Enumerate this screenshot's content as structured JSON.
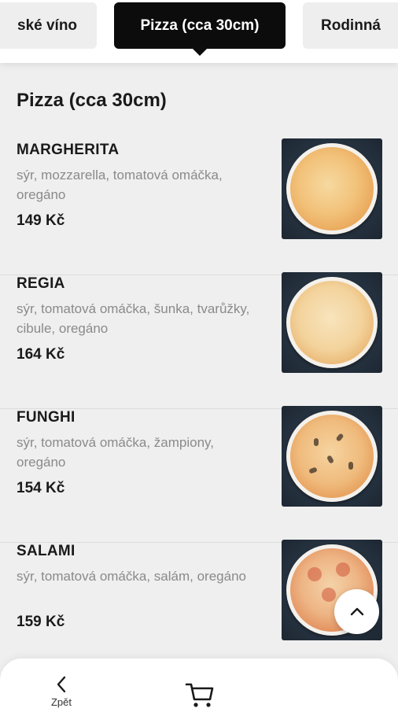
{
  "categories": [
    {
      "label": "ské víno",
      "active": false
    },
    {
      "label": "Pizza (cca 30cm)",
      "active": true
    },
    {
      "label": "Rodinná",
      "active": false
    }
  ],
  "section": {
    "title": "Pizza (cca 30cm)"
  },
  "items": [
    {
      "name": "MARGHERITA",
      "description": "sýr, mozzarella, tomatová omáčka, oregáno",
      "price": "149 Kč"
    },
    {
      "name": "REGIA",
      "description": "sýr, tomatová omáčka, šunka, tvarůžky, cibule, oregáno",
      "price": "164 Kč"
    },
    {
      "name": "FUNGHI",
      "description": "sýr, tomatová omáčka, žampiony, oregáno",
      "price": "154 Kč"
    },
    {
      "name": "SALAMI",
      "description": "sýr, tomatová omáčka, salám, oregáno",
      "price": "159 Kč"
    }
  ],
  "scroll_top": {
    "icon": "chevron-up-icon"
  },
  "bottom_nav": {
    "back_label": "Zpět",
    "back_icon": "chevron-left-icon",
    "cart_icon": "cart-icon"
  },
  "colors": {
    "background": "#efefef",
    "active_tab": "#0c0c0c",
    "inactive_tab": "#eeeeee",
    "description": "#8a8a8a"
  }
}
